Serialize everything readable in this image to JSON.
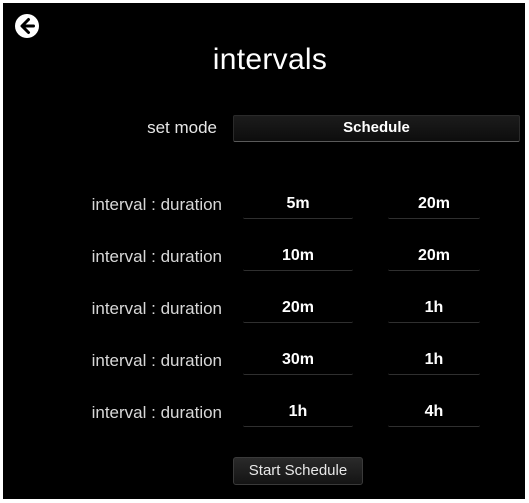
{
  "header": {
    "back_icon": "back-arrow-icon",
    "title": "intervals"
  },
  "mode": {
    "label": "set mode",
    "value": "Schedule"
  },
  "rows": [
    {
      "label": "interval : duration",
      "interval": "5m",
      "duration": "20m"
    },
    {
      "label": "interval : duration",
      "interval": "10m",
      "duration": "20m"
    },
    {
      "label": "interval : duration",
      "interval": "20m",
      "duration": "1h"
    },
    {
      "label": "interval : duration",
      "interval": "30m",
      "duration": "1h"
    },
    {
      "label": "interval : duration",
      "interval": "1h",
      "duration": "4h"
    }
  ],
  "actions": {
    "start_label": "Start Schedule"
  },
  "colors": {
    "background": "#000000",
    "text": "#ffffff"
  }
}
